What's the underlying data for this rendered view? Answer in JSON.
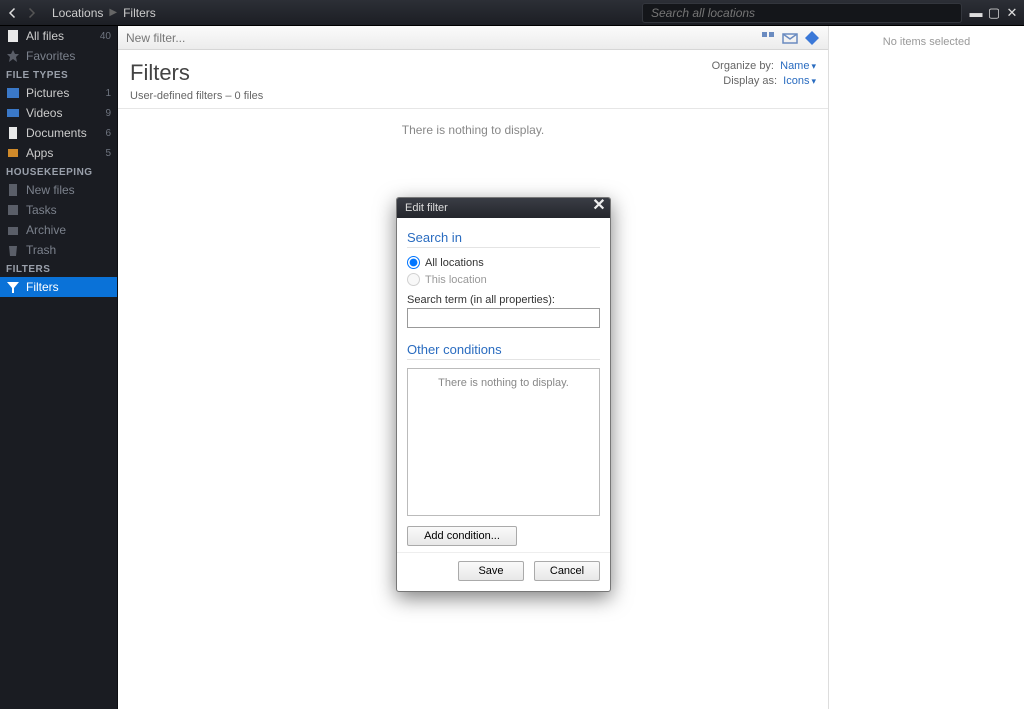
{
  "topbar": {
    "breadcrumb": [
      "Locations",
      "Filters"
    ],
    "search_placeholder": "Search all locations"
  },
  "sidebar": {
    "top": [
      {
        "icon": "file-icon",
        "label": "All files",
        "count": "40"
      },
      {
        "icon": "star-icon",
        "label": "Favorites",
        "dim": true
      }
    ],
    "sections": [
      {
        "header": "FILE TYPES",
        "items": [
          {
            "icon": "picture-icon",
            "label": "Pictures",
            "count": "1"
          },
          {
            "icon": "video-icon",
            "label": "Videos",
            "count": "9"
          },
          {
            "icon": "document-icon",
            "label": "Documents",
            "count": "6"
          },
          {
            "icon": "apps-icon",
            "label": "Apps",
            "count": "5"
          }
        ]
      },
      {
        "header": "HOUSEKEEPING",
        "items": [
          {
            "icon": "newfiles-icon",
            "label": "New files",
            "dim": true
          },
          {
            "icon": "tasks-icon",
            "label": "Tasks",
            "dim": true
          },
          {
            "icon": "archive-icon",
            "label": "Archive",
            "dim": true
          },
          {
            "icon": "trash-icon",
            "label": "Trash",
            "dim": true
          }
        ]
      },
      {
        "header": "FILTERS",
        "items": [
          {
            "icon": "filter-icon",
            "label": "Filters",
            "selected": true
          }
        ]
      }
    ]
  },
  "toolbar": {
    "new_filter": "New filter..."
  },
  "page": {
    "title": "Filters",
    "subtitle": "User-defined filters – 0 files",
    "organize_label": "Organize by:",
    "organize_value": "Name",
    "display_label": "Display as:",
    "display_value": "Icons",
    "empty_message": "There is nothing to display."
  },
  "details": {
    "no_selection": "No items selected"
  },
  "modal": {
    "title": "Edit filter",
    "search_in": "Search in",
    "radio_all": "All locations",
    "radio_this": "This location",
    "term_label": "Search term (in all properties):",
    "other_conditions": "Other conditions",
    "conditions_empty": "There is nothing to display.",
    "add_condition": "Add condition...",
    "save": "Save",
    "cancel": "Cancel"
  }
}
